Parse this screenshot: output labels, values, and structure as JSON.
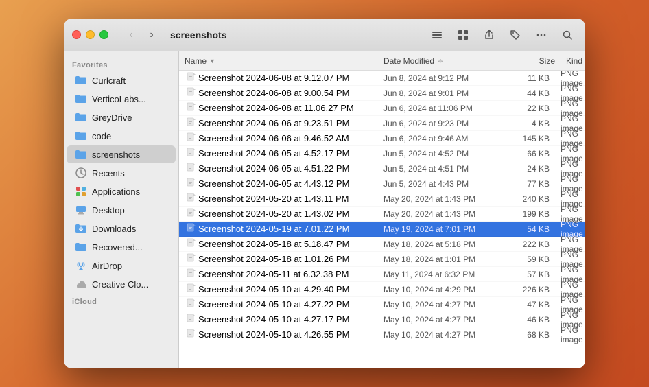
{
  "window": {
    "title": "screenshots"
  },
  "titlebar": {
    "back_label": "‹",
    "forward_label": "›",
    "list_view_icon": "≡",
    "grid_view_icon": "⊞",
    "share_icon": "↑",
    "tag_icon": "⊙",
    "more_icon": "•••",
    "search_icon": "⌕"
  },
  "sidebar": {
    "favorites_label": "Favorites",
    "icloud_label": "iCloud",
    "items": [
      {
        "id": "curlcraft",
        "label": "Curlcraft",
        "icon": "📁",
        "active": false
      },
      {
        "id": "verticolabs",
        "label": "VerticoLabs...",
        "icon": "📁",
        "active": false
      },
      {
        "id": "greydrive",
        "label": "GreyDrive",
        "icon": "📁",
        "active": false
      },
      {
        "id": "code",
        "label": "code",
        "icon": "📁",
        "active": false
      },
      {
        "id": "screenshots",
        "label": "screenshots",
        "icon": "📁",
        "active": true
      },
      {
        "id": "recents",
        "label": "Recents",
        "icon": "🕐",
        "active": false
      },
      {
        "id": "applications",
        "label": "Applications",
        "icon": "🚀",
        "active": false
      },
      {
        "id": "desktop",
        "label": "Desktop",
        "icon": "🖥",
        "active": false
      },
      {
        "id": "downloads",
        "label": "Downloads",
        "icon": "📥",
        "active": false
      },
      {
        "id": "recovered",
        "label": "Recovered...",
        "icon": "📁",
        "active": false
      },
      {
        "id": "airdrop",
        "label": "AirDrop",
        "icon": "📡",
        "active": false
      },
      {
        "id": "creativeclo",
        "label": "Creative Clo...",
        "icon": "☁",
        "active": false
      }
    ]
  },
  "columns": {
    "name": "Name",
    "date_modified": "Date Modified",
    "size": "Size",
    "kind": "Kind"
  },
  "files": [
    {
      "name": "Screenshot 2024-06-08 at 9.12.07 PM",
      "date": "Jun 8, 2024 at 9:12 PM",
      "size": "11 KB",
      "kind": "PNG image",
      "selected": false
    },
    {
      "name": "Screenshot 2024-06-08 at 9.00.54 PM",
      "date": "Jun 8, 2024 at 9:01 PM",
      "size": "44 KB",
      "kind": "PNG image",
      "selected": false
    },
    {
      "name": "Screenshot 2024-06-08 at 11.06.27 PM",
      "date": "Jun 6, 2024 at 11:06 PM",
      "size": "22 KB",
      "kind": "PNG image",
      "selected": false
    },
    {
      "name": "Screenshot 2024-06-06 at 9.23.51 PM",
      "date": "Jun 6, 2024 at 9:23 PM",
      "size": "4 KB",
      "kind": "PNG image",
      "selected": false
    },
    {
      "name": "Screenshot 2024-06-06 at 9.46.52 AM",
      "date": "Jun 6, 2024 at 9:46 AM",
      "size": "145 KB",
      "kind": "PNG image",
      "selected": false
    },
    {
      "name": "Screenshot 2024-06-05 at 4.52.17 PM",
      "date": "Jun 5, 2024 at 4:52 PM",
      "size": "66 KB",
      "kind": "PNG image",
      "selected": false
    },
    {
      "name": "Screenshot 2024-06-05 at 4.51.22 PM",
      "date": "Jun 5, 2024 at 4:51 PM",
      "size": "24 KB",
      "kind": "PNG image",
      "selected": false
    },
    {
      "name": "Screenshot 2024-06-05 at 4.43.12 PM",
      "date": "Jun 5, 2024 at 4:43 PM",
      "size": "77 KB",
      "kind": "PNG image",
      "selected": false
    },
    {
      "name": "Screenshot 2024-05-20 at 1.43.11 PM",
      "date": "May 20, 2024 at 1:43 PM",
      "size": "240 KB",
      "kind": "PNG image",
      "selected": false
    },
    {
      "name": "Screenshot 2024-05-20 at 1.43.02 PM",
      "date": "May 20, 2024 at 1:43 PM",
      "size": "199 KB",
      "kind": "PNG image",
      "selected": false
    },
    {
      "name": "Screenshot 2024-05-19 at 7.01.22 PM",
      "date": "May 19, 2024 at 7:01 PM",
      "size": "54 KB",
      "kind": "PNG image",
      "selected": true
    },
    {
      "name": "Screenshot 2024-05-18 at 5.18.47 PM",
      "date": "May 18, 2024 at 5:18 PM",
      "size": "222 KB",
      "kind": "PNG image",
      "selected": false
    },
    {
      "name": "Screenshot 2024-05-18 at 1.01.26 PM",
      "date": "May 18, 2024 at 1:01 PM",
      "size": "59 KB",
      "kind": "PNG image",
      "selected": false
    },
    {
      "name": "Screenshot 2024-05-11 at 6.32.38 PM",
      "date": "May 11, 2024 at 6:32 PM",
      "size": "57 KB",
      "kind": "PNG image",
      "selected": false
    },
    {
      "name": "Screenshot 2024-05-10 at 4.29.40 PM",
      "date": "May 10, 2024 at 4:29 PM",
      "size": "226 KB",
      "kind": "PNG image",
      "selected": false
    },
    {
      "name": "Screenshot 2024-05-10 at 4.27.22 PM",
      "date": "May 10, 2024 at 4:27 PM",
      "size": "47 KB",
      "kind": "PNG image",
      "selected": false
    },
    {
      "name": "Screenshot 2024-05-10 at 4.27.17 PM",
      "date": "May 10, 2024 at 4:27 PM",
      "size": "46 KB",
      "kind": "PNG image",
      "selected": false
    },
    {
      "name": "Screenshot 2024-05-10 at 4.26.55 PM",
      "date": "May 10, 2024 at 4:27 PM",
      "size": "68 KB",
      "kind": "PNG image",
      "selected": false
    }
  ]
}
